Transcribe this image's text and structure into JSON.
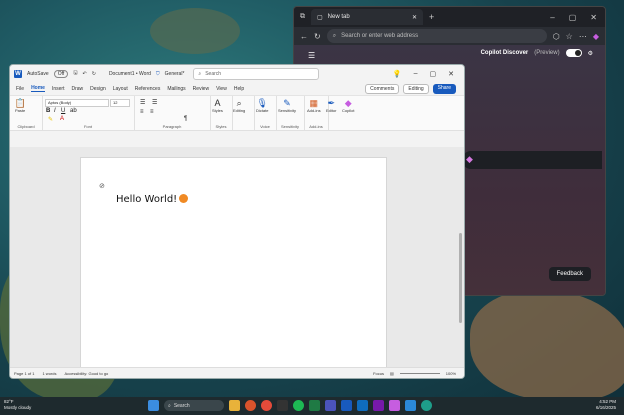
{
  "edge": {
    "tab_title": "New tab",
    "address_placeholder": "Search or enter web address",
    "copilot_label": "Copilot Discover",
    "copilot_sub": "(Preview)",
    "feedback_label": "Feedback"
  },
  "word": {
    "autosave_label": "AutoSave",
    "autosave_state": "Off",
    "doc_title": "Document1 • Word",
    "sensitivity_label": "General*",
    "search_placeholder": "Search",
    "menu": [
      "File",
      "Home",
      "Insert",
      "Draw",
      "Design",
      "Layout",
      "References",
      "Mailings",
      "Review",
      "View",
      "Help"
    ],
    "active_menu": "Home",
    "comments_label": "Comments",
    "editing_label": "Editing",
    "share_label": "Share",
    "font_name": "Aptos (Body)",
    "font_size": "12",
    "groups": [
      "Clipboard",
      "Font",
      "Paragraph",
      "Styles",
      "Voice",
      "Sensitivity",
      "Add-ins"
    ],
    "buttons": {
      "paste": "Paste",
      "styles": "Styles",
      "editing": "Editing",
      "dictate": "Dictate",
      "sensitivity": "Sensitivity",
      "addins": "Add-ins",
      "editor": "Editor",
      "copilot": "Copilot"
    },
    "document_text": "Hello World!",
    "status": {
      "page": "Page 1 of 1",
      "words": "1 words",
      "accessibility": "Accessibility: Good to go",
      "focus": "Focus",
      "zoom": "100%"
    }
  },
  "taskbar": {
    "temp": "82°F",
    "condition": "Mostly cloudy",
    "search_label": "Search",
    "time": "4:52 PM",
    "date": "6/16/2025"
  }
}
